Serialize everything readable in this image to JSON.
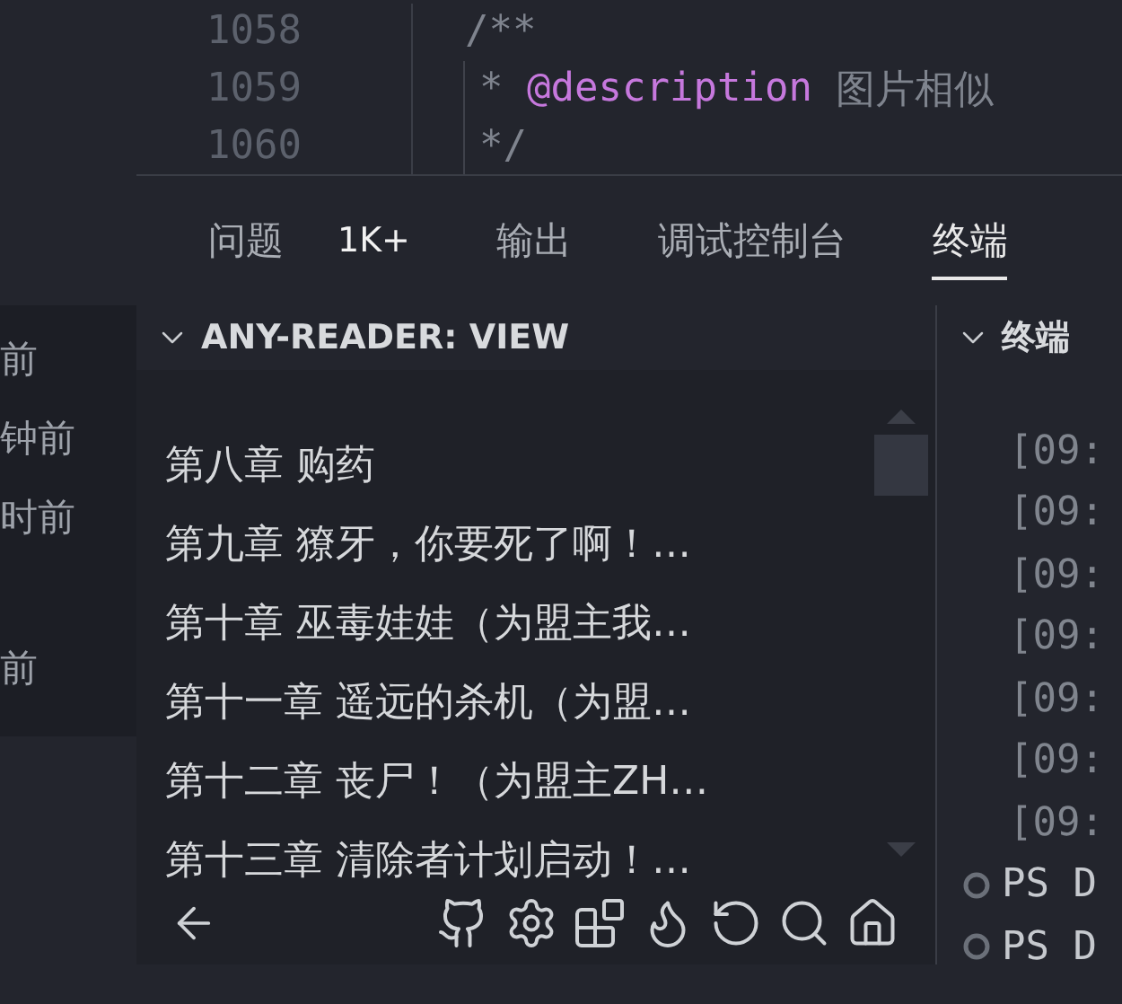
{
  "editor": {
    "lines": [
      {
        "number": "1058",
        "parts": [
          {
            "kind": "comment",
            "text": "/**"
          }
        ]
      },
      {
        "number": "1059",
        "parts": [
          {
            "kind": "comment",
            "text": "* "
          },
          {
            "kind": "tag",
            "text": "@description"
          },
          {
            "kind": "comment",
            "text": " 图片相似"
          }
        ]
      },
      {
        "number": "1060",
        "parts": [
          {
            "kind": "comment",
            "text": "*/"
          }
        ]
      }
    ]
  },
  "side_list": {
    "items": [
      "前",
      "钟前",
      "时前",
      "前"
    ]
  },
  "tabs": [
    {
      "label": "问题",
      "badge": "1K+",
      "selected": false
    },
    {
      "label": "输出",
      "selected": false
    },
    {
      "label": "调试控制台",
      "selected": false
    },
    {
      "label": "终端",
      "selected": true
    }
  ],
  "view": {
    "title": "ANY-READER: VIEW",
    "expanded": true,
    "chapters": [
      "第八章 购药",
      "第九章 獠牙，你要死了啊！…",
      "第十章 巫毒娃娃（为盟主我…",
      "第十一章 遥远的杀机（为盟…",
      "第十二章 丧尸！（为盟主ZH…",
      "第十三章 清除者计划启动！…"
    ]
  },
  "terminal": {
    "title": "终端",
    "expanded": true,
    "lines": [
      {
        "kind": "log",
        "text": "[09:"
      },
      {
        "kind": "log",
        "text": "[09:"
      },
      {
        "kind": "log",
        "text": "[09:"
      },
      {
        "kind": "log",
        "text": "[09:"
      },
      {
        "kind": "log",
        "text": "[09:"
      },
      {
        "kind": "log",
        "text": "[09:"
      },
      {
        "kind": "log",
        "text": "[09:"
      },
      {
        "kind": "prompt",
        "text": "PS D"
      },
      {
        "kind": "prompt",
        "text": "PS D"
      }
    ]
  }
}
